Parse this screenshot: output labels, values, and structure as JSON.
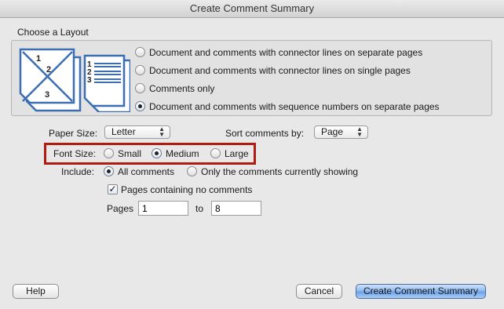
{
  "window": {
    "title": "Create Comment Summary"
  },
  "layout": {
    "group_label": "Choose a Layout",
    "icon_numbers": [
      "1",
      "2",
      "3"
    ],
    "options": [
      "Document and comments with connector lines on separate pages",
      "Document and comments with connector lines on single pages",
      "Comments only",
      "Document and comments with sequence numbers on separate pages"
    ],
    "selected_index": 3
  },
  "paper_size": {
    "label": "Paper Size:",
    "value": "Letter"
  },
  "sort": {
    "label": "Sort comments by:",
    "value": "Page"
  },
  "font_size": {
    "label": "Font Size:",
    "options": [
      "Small",
      "Medium",
      "Large"
    ],
    "selected": "Medium"
  },
  "include": {
    "label": "Include:",
    "options": [
      "All comments",
      "Only the comments currently showing"
    ],
    "selected": "All comments"
  },
  "no_comments_pages": {
    "label": "Pages containing no comments",
    "checked": true
  },
  "pages": {
    "label": "Pages",
    "from": "1",
    "to_label": "to",
    "to": "8"
  },
  "buttons": {
    "help": "Help",
    "cancel": "Cancel",
    "create": "Create Comment Summary"
  },
  "colors": {
    "highlight": "#b11c12",
    "default_button": "#6aa0e8"
  }
}
